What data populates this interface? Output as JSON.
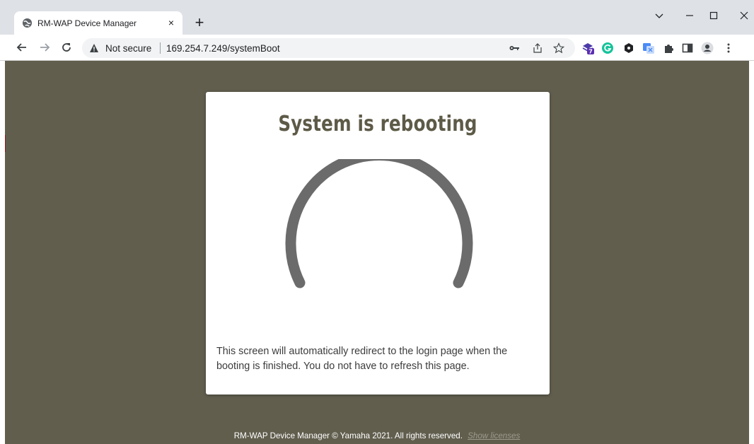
{
  "browser": {
    "tab": {
      "title": "RM-WAP Device Manager",
      "close_label": "×"
    },
    "new_tab_label": "+",
    "omnibox": {
      "security_label": "Not secure",
      "url": "169.254.7.249/systemBoot"
    },
    "extensions": [
      {
        "icon": "layers-extension-icon",
        "badge": "7"
      },
      {
        "icon": "grammarly-icon"
      },
      {
        "icon": "cube-extension-icon"
      },
      {
        "icon": "translate-extension-icon"
      },
      {
        "icon": "puzzle-extensions-icon"
      },
      {
        "icon": "side-panel-icon"
      },
      {
        "icon": "profile-avatar-icon"
      },
      {
        "icon": "more-menu-icon"
      }
    ]
  },
  "page": {
    "title": "System is rebooting",
    "message": "This screen will automatically redirect to the login page when the booting is finished. You do not have to refresh this page.",
    "footer_text": "RM-WAP Device Manager © Yamaha 2021. All rights reserved.",
    "footer_link": "Show licenses"
  },
  "colors": {
    "page_background": "#615e4e",
    "title": "#5d5a47",
    "spinner": "#6b6b6b",
    "chrome_frame": "#dee1e6"
  }
}
